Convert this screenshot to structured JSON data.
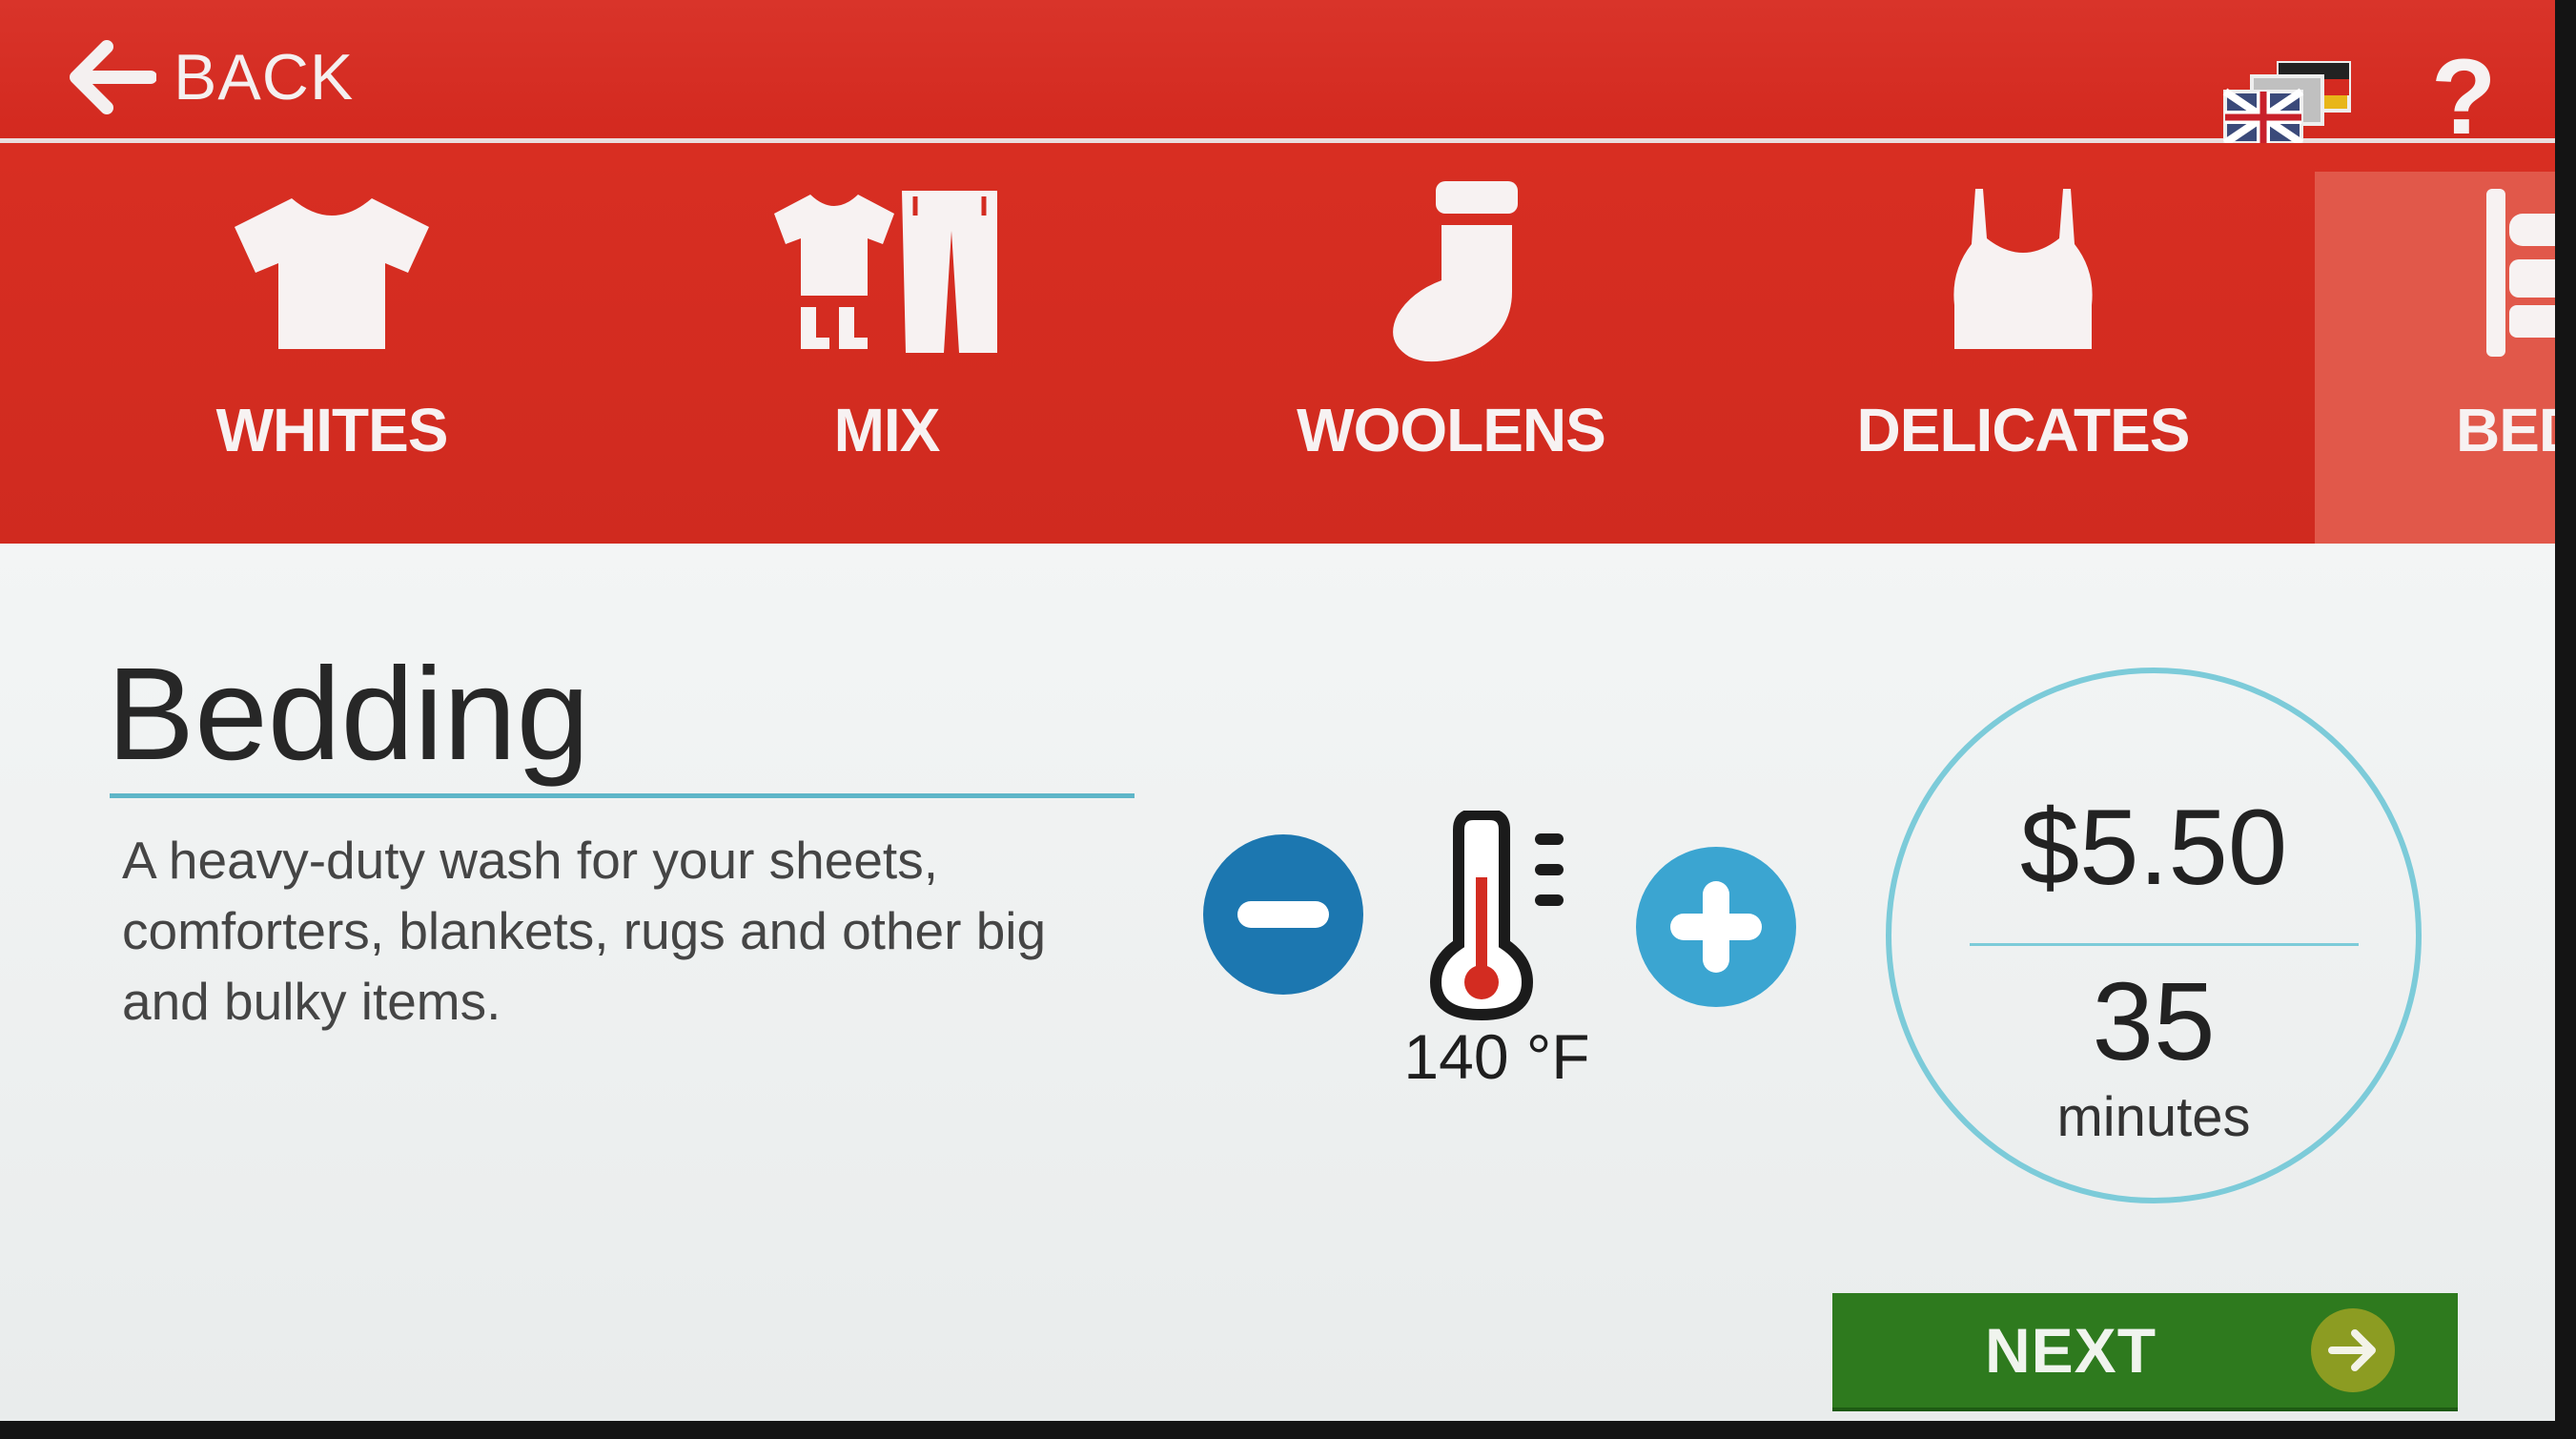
{
  "header": {
    "back_label": "BACK",
    "help_label": "?"
  },
  "categories": [
    {
      "label": "WHITES",
      "icon": "tshirt-icon"
    },
    {
      "label": "MIX",
      "icon": "mixed-clothes-icon"
    },
    {
      "label": "WOOLENS",
      "icon": "sock-icon"
    },
    {
      "label": "DELICATES",
      "icon": "camisole-icon"
    },
    {
      "label": "BED",
      "icon": "bed-icon"
    }
  ],
  "program": {
    "title": "Bedding",
    "description": "A heavy-duty wash for your sheets, comforters, blankets, rugs and other big and bulky items.",
    "temperature": "140 °F",
    "price": "$5.50",
    "duration_value": "35",
    "duration_unit": "minutes"
  },
  "actions": {
    "next_label": "NEXT"
  },
  "colors": {
    "header_red": "#d62f23",
    "price_ring": "#7ccbd9",
    "next_green": "#2e7a1e",
    "minus_blue": "#1c77b0",
    "plus_blue": "#3ba5d1"
  }
}
